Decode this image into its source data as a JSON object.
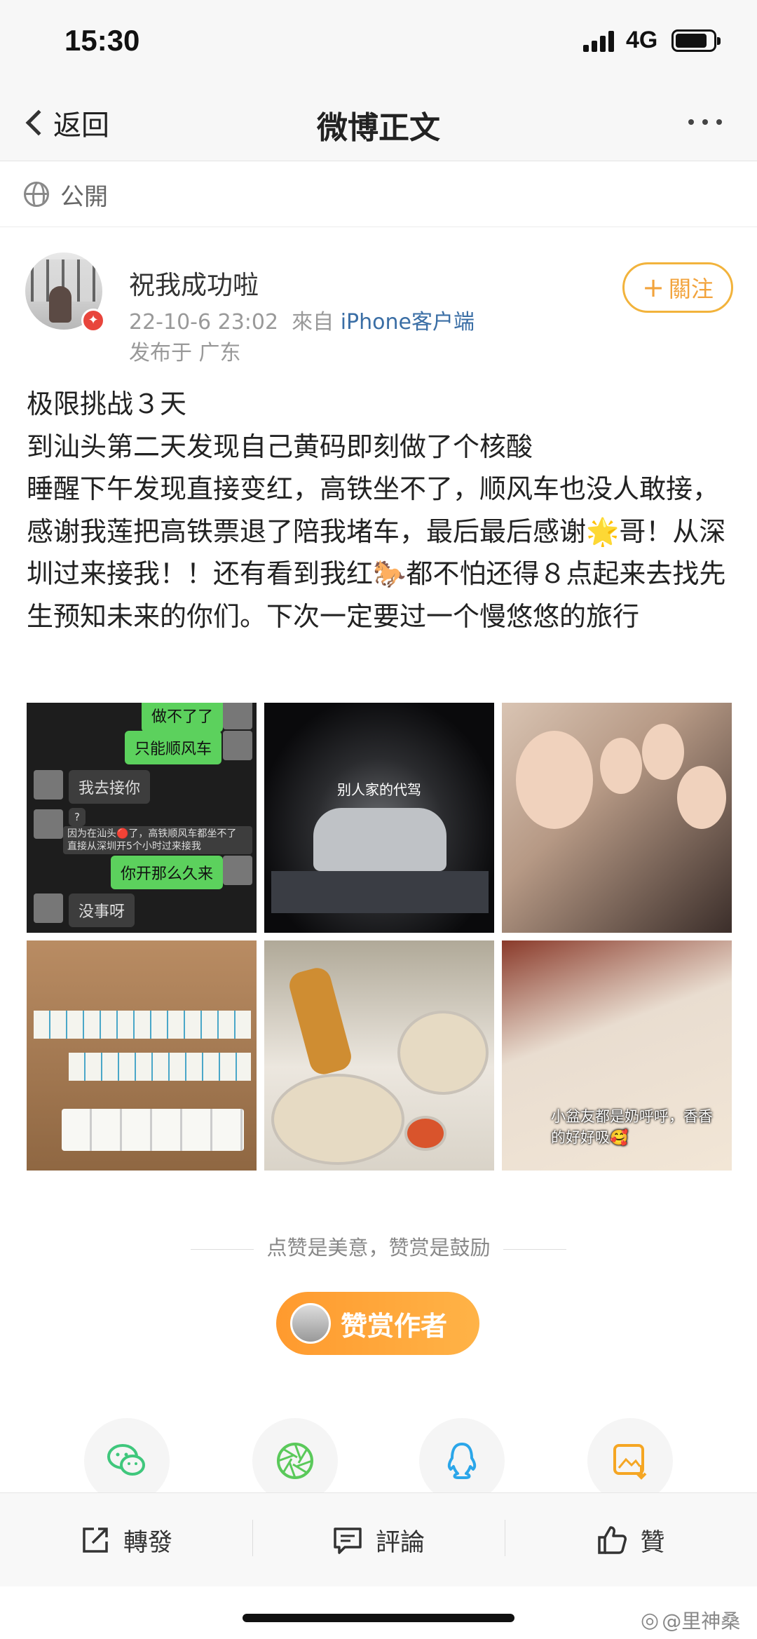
{
  "status_bar": {
    "time": "15:30",
    "network": "4G"
  },
  "nav": {
    "back_label": "返回",
    "title": "微博正文"
  },
  "visibility": {
    "label": "公開"
  },
  "post": {
    "username": "祝我成功啦",
    "timestamp": "22-10-6 23:02",
    "source_prefix": "來自",
    "source": "iPhone客户端",
    "location": "发布于 广东",
    "follow_label": "關注",
    "body_lines": [
      "极限挑战３天",
      "到汕头第二天发现自己黄码即刻做了个核酸",
      "睡醒下午发现直接变红，高铁坐不了，顺风车也没人敢接，感谢我莲把高铁票退了陪我堵车，最后最后感谢🌟哥！从深圳过来接我！！还有看到我红🐎都不怕还得８点起来去找先生预知未来的你们。下次一定要过一个慢悠悠的旅行"
    ],
    "images": [
      {
        "type": "chat-screenshot",
        "texts": [
          "做不了了",
          "只能顺风车",
          "我去接你",
          "?",
          "因为在汕头🔴了，高铁顺风车都坐不了",
          "直接从深圳开5个小时过来接我",
          "你开那么久来",
          "没事呀"
        ]
      },
      {
        "type": "car-on-tow-truck",
        "caption": "别人家的代驾"
      },
      {
        "type": "group-selfie"
      },
      {
        "type": "mahjong-table"
      },
      {
        "type": "food"
      },
      {
        "type": "baby",
        "caption": "小盆友都是奶呼呼，香香的好好吸🥰"
      }
    ]
  },
  "appreciate": {
    "hint": "点赞是美意，赞赏是鼓励",
    "button_label": "赞赏作者"
  },
  "share_targets": [
    {
      "icon": "wechat-icon",
      "color": "#3fc77c"
    },
    {
      "icon": "moments-icon",
      "color": "#5ac95a"
    },
    {
      "icon": "qq-icon",
      "color": "#2ba6e9"
    },
    {
      "icon": "save-image-icon",
      "color": "#f5a623"
    }
  ],
  "actions": {
    "repost": "轉發",
    "comment": "評論",
    "like": "贊"
  },
  "watermark": "@里神桑"
}
